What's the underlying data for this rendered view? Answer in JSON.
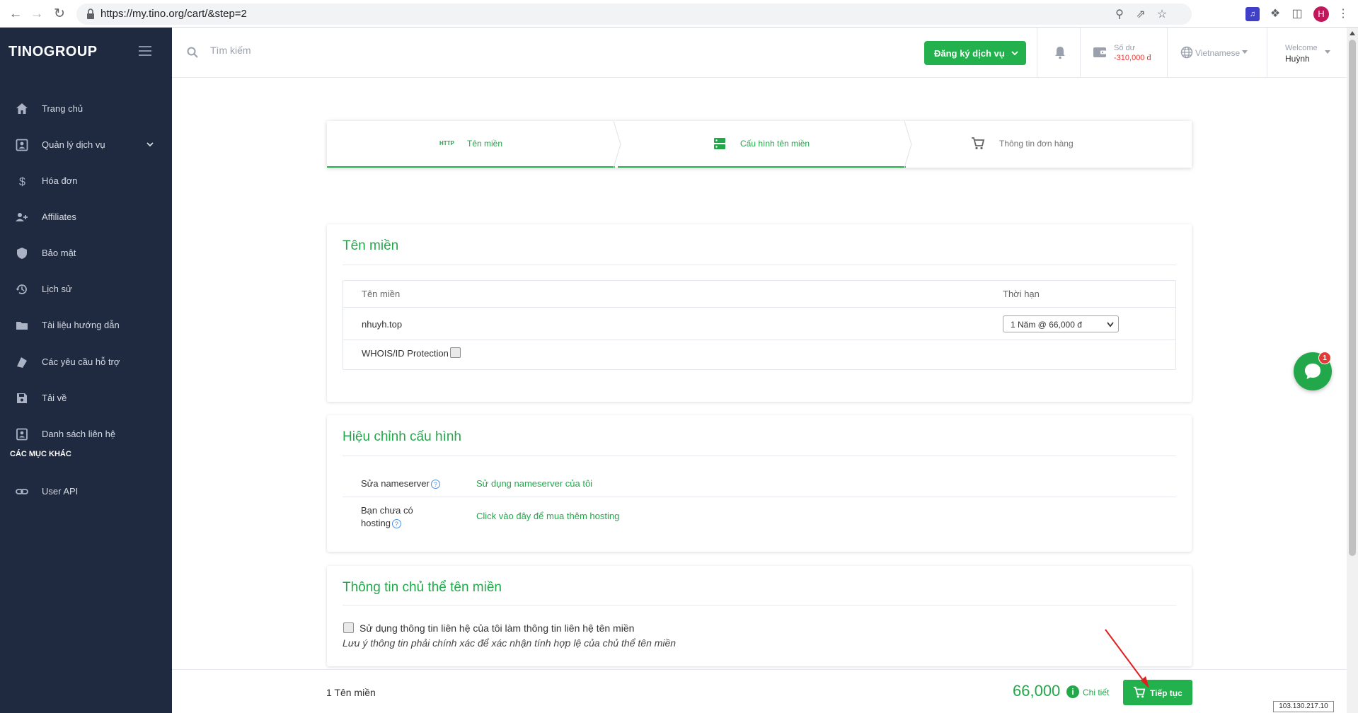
{
  "browser": {
    "url": "https://my.tino.org/cart/&step=2",
    "profile_initial": "H"
  },
  "sidebar": {
    "logo": "TINOGROUP",
    "items": [
      {
        "label": "Trang chủ",
        "icon": "home-icon"
      },
      {
        "label": "Quản lý dịch vụ",
        "icon": "account-box-icon"
      },
      {
        "label": "Hóa đơn",
        "icon": "dollar-icon"
      },
      {
        "label": "Affiliates",
        "icon": "people-icon"
      },
      {
        "label": "Bảo mật",
        "icon": "shield-icon"
      },
      {
        "label": "Lịch sử",
        "icon": "history-icon"
      },
      {
        "label": "Tài liệu hướng dẫn",
        "icon": "folder-icon"
      },
      {
        "label": "Các yêu cầu hỗ trợ",
        "icon": "support-icon"
      },
      {
        "label": "Tải về",
        "icon": "save-icon"
      },
      {
        "label": "Danh sách liên hệ",
        "icon": "contact-icon"
      }
    ],
    "section_title": "CÁC MỤC KHÁC",
    "extra_items": [
      {
        "label": "User API",
        "icon": "link-icon"
      }
    ]
  },
  "header": {
    "search_placeholder": "Tìm kiếm",
    "register_button": "Đăng ký dịch vụ",
    "balance_label": "Số dư",
    "balance_value": "-310,000 đ",
    "language": "Vietnamese",
    "welcome_label": "Welcome",
    "user_name": "Huỳnh"
  },
  "steps": [
    {
      "badge": "HTTP",
      "label": "Tên miền",
      "state": "done"
    },
    {
      "label": "Cấu hình tên miền",
      "state": "active"
    },
    {
      "label": "Thông tin đơn hàng",
      "state": "pending"
    }
  ],
  "domain_card": {
    "title": "Tên miền",
    "col_domain": "Tên miền",
    "col_period": "Thời hạn",
    "domain": "nhuyh.top",
    "period_selected": "1 Năm @ 66,000 đ",
    "whois_label": "WHOIS/ID Protection"
  },
  "config_card": {
    "title": "Hiệu chỉnh cấu hình",
    "nameserver_label": "Sửa nameserver",
    "nameserver_link": "Sử dụng nameserver của tôi",
    "hosting_label_1": "Bạn chưa có",
    "hosting_label_2": "hosting",
    "hosting_link": "Click vào đây để mua thêm hosting",
    "help_glyph": "?"
  },
  "owner_card": {
    "title": "Thông tin chủ thể tên miền",
    "checkbox_label": "Sử dụng thông tin liên hệ của tôi làm thông tin liên hệ tên miền",
    "note": "Lưu ý thông tin phải chính xác để xác nhận tính hợp lệ của chủ thể tên miền"
  },
  "footer": {
    "cart_count": "1 Tên miền",
    "total": "66,000",
    "info_glyph": "i",
    "detail": "Chi tiết",
    "continue": "Tiếp tục"
  },
  "chat": {
    "badge": "1"
  },
  "ip": "103.130.217.10",
  "colors": {
    "accent": "#22b14c",
    "sidebar": "#1f2a40",
    "balance": "#e53935"
  }
}
